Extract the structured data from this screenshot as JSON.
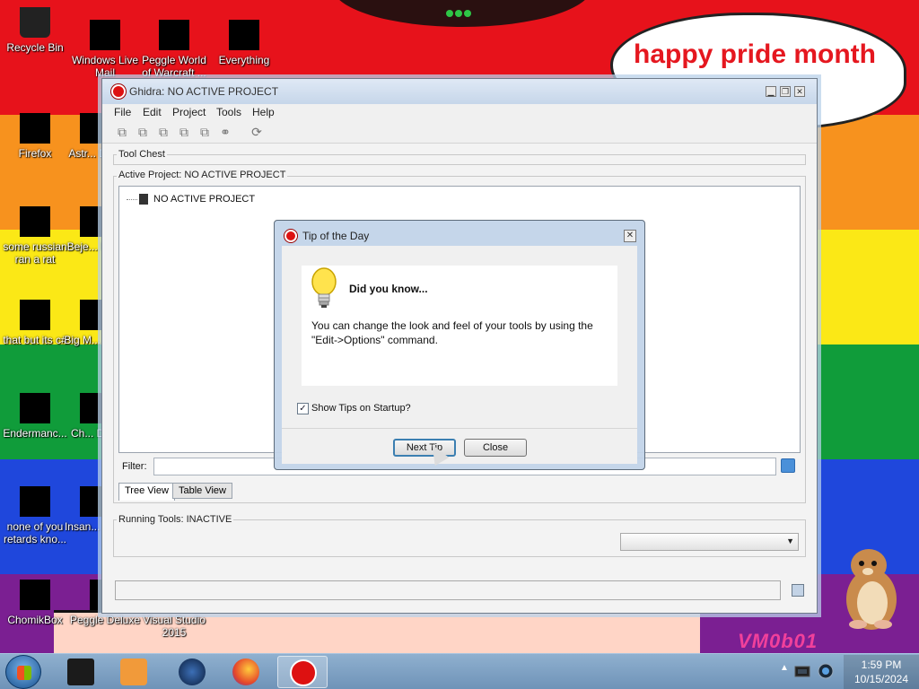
{
  "desktop": {
    "banner_text": "happy pride month",
    "watermark": "VM0b01",
    "icons": [
      {
        "label": "Recycle Bin"
      },
      {
        "label": "Windows Live Mail"
      },
      {
        "label": "Peggle World of Warcraft ..."
      },
      {
        "label": "Everything"
      },
      {
        "label": "Firefox"
      },
      {
        "label": "Astr... De..."
      },
      {
        "label": "some russian ran a rat"
      },
      {
        "label": "Beje... De..."
      },
      {
        "label": "that but its c#"
      },
      {
        "label": "Big M... De..."
      },
      {
        "label": "Endermanc..."
      },
      {
        "label": "Ch... De..."
      },
      {
        "label": "none of you retards kno..."
      },
      {
        "label": "Insan... De..."
      },
      {
        "label": "ChomikBox"
      },
      {
        "label": "Peggle Deluxe"
      },
      {
        "label": "Visual Studio 2015"
      }
    ]
  },
  "ghidra": {
    "title": "Ghidra: NO ACTIVE PROJECT",
    "menu": [
      "File",
      "Edit",
      "Project",
      "Tools",
      "Help"
    ],
    "tool_chest_label": "Tool Chest",
    "active_project_label": "Active Project: NO ACTIVE PROJECT",
    "tree_item": "NO ACTIVE PROJECT",
    "filter_label": "Filter:",
    "filter_value": "",
    "tabs": [
      "Tree View",
      "Table View"
    ],
    "running_tools_label": "Running Tools: INACTIVE",
    "running_tools_selected": ""
  },
  "tip_dialog": {
    "title": "Tip of the Day",
    "heading": "Did you know...",
    "text": "You can change the look and feel of your tools by using the \"Edit->Options\" command.",
    "show_tips_label": "Show Tips on Startup?",
    "show_tips_checked": "✓",
    "next_button": "Next Tip",
    "close_button": "Close"
  },
  "taskbar": {
    "time": "1:59 PM",
    "date": "10/15/2024",
    "tray_arrow": "▲"
  },
  "icons": {
    "close": "✕",
    "restore": "❐",
    "minimize": "▁",
    "combo_arrow": "▼"
  }
}
